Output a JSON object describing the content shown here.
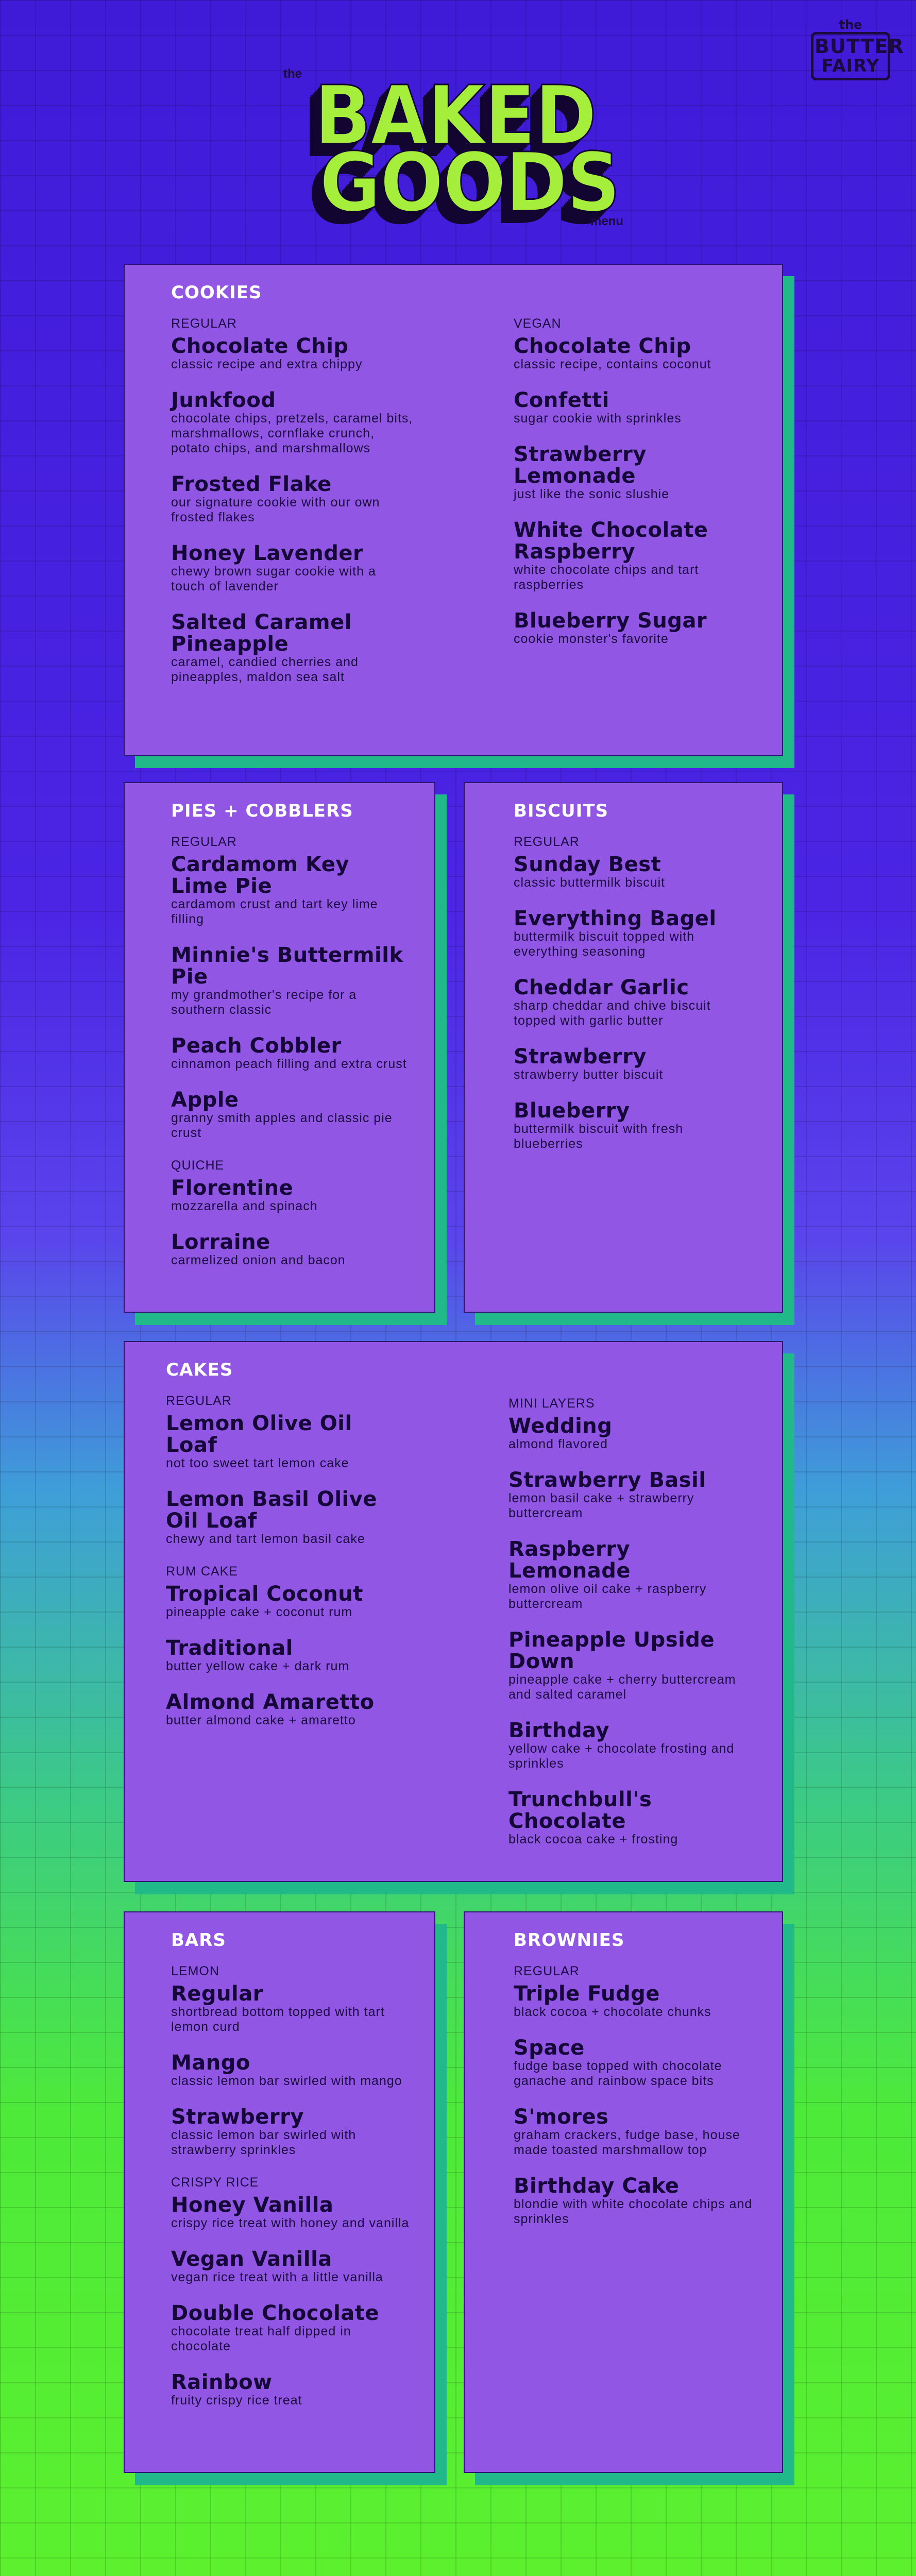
{
  "brand": {
    "the_small": "the",
    "badge_line1": "BUTTER",
    "badge_line2": "FAIRY"
  },
  "header": {
    "the_label": "the",
    "title_line1": "BAKED",
    "title_line2": "GOODS",
    "menu_label": "menu"
  },
  "sections": {
    "cookies": {
      "title": "COOKIES",
      "left": {
        "subhead": "REGULAR",
        "items": [
          {
            "name": "Chocolate Chip",
            "desc": "classic recipe and extra chippy"
          },
          {
            "name": "Junkfood",
            "desc": "chocolate chips, pretzels, caramel bits, marshmallows, cornflake crunch, potato chips, and marshmallows"
          },
          {
            "name": "Frosted Flake",
            "desc": "our signature cookie with our own frosted flakes"
          },
          {
            "name": "Honey Lavender",
            "desc": "chewy brown sugar cookie with a touch of lavender"
          },
          {
            "name": "Salted Caramel Pineapple",
            "desc": "caramel, candied cherries and pineapples, maldon sea salt"
          }
        ]
      },
      "right": {
        "subhead": "VEGAN",
        "items": [
          {
            "name": "Chocolate Chip",
            "desc": "classic recipe, contains coconut"
          },
          {
            "name": "Confetti",
            "desc": "sugar cookie with sprinkles"
          },
          {
            "name": "Strawberry Lemonade",
            "desc": "just like the sonic slushie"
          },
          {
            "name": "White Chocolate Raspberry",
            "desc": "white chocolate chips and tart raspberries"
          },
          {
            "name": "Blueberry Sugar",
            "desc": "cookie monster's favorite"
          }
        ]
      }
    },
    "pies": {
      "title": "PIES + COBBLERS",
      "groups": [
        {
          "subhead": "REGULAR",
          "items": [
            {
              "name": "Cardamom Key Lime Pie",
              "desc": "cardamom crust and tart key lime filling"
            },
            {
              "name": "Minnie's Buttermilk Pie",
              "desc": "my grandmother's recipe for a southern classic"
            },
            {
              "name": "Peach Cobbler",
              "desc": "cinnamon peach filling and extra crust"
            },
            {
              "name": "Apple",
              "desc": "granny smith apples and classic pie crust"
            }
          ]
        },
        {
          "subhead": "QUICHE",
          "items": [
            {
              "name": "Florentine",
              "desc": "mozzarella and spinach"
            },
            {
              "name": "Lorraine",
              "desc": "carmelized onion and bacon"
            }
          ]
        }
      ]
    },
    "biscuits": {
      "title": "BISCUITS",
      "groups": [
        {
          "subhead": "REGULAR",
          "items": [
            {
              "name": "Sunday Best",
              "desc": "classic buttermilk biscuit"
            },
            {
              "name": "Everything Bagel",
              "desc": "buttermilk biscuit topped with everything seasoning"
            },
            {
              "name": "Cheddar Garlic",
              "desc": "sharp cheddar and chive biscuit topped with garlic butter"
            },
            {
              "name": "Strawberry",
              "desc": "strawberry butter biscuit"
            },
            {
              "name": "Blueberry",
              "desc": "buttermilk biscuit with fresh blueberries"
            }
          ]
        }
      ]
    },
    "cakes": {
      "title": "CAKES",
      "left": [
        {
          "subhead": "REGULAR",
          "items": [
            {
              "name": "Lemon Olive Oil Loaf",
              "desc": "not too sweet tart lemon cake"
            },
            {
              "name": "Lemon Basil Olive Oil Loaf",
              "desc": "chewy and tart lemon basil cake"
            }
          ]
        },
        {
          "subhead": "RUM CAKE",
          "items": [
            {
              "name": "Tropical Coconut",
              "desc": "pineapple cake + coconut rum"
            },
            {
              "name": "Traditional",
              "desc": "butter yellow cake + dark rum"
            },
            {
              "name": "Almond Amaretto",
              "desc": "butter almond cake + amaretto"
            }
          ]
        }
      ],
      "right": [
        {
          "subhead": "MINI LAYERS",
          "items": [
            {
              "name": "Wedding",
              "desc": "almond flavored"
            },
            {
              "name": "Strawberry Basil",
              "desc": "lemon basil cake + strawberry buttercream"
            },
            {
              "name": "Raspberry Lemonade",
              "desc": "lemon olive oil cake + raspberry buttercream"
            },
            {
              "name": "Pineapple Upside Down",
              "desc": "pineapple cake + cherry buttercream and salted caramel"
            },
            {
              "name": "Birthday",
              "desc": "yellow cake + chocolate frosting and sprinkles"
            },
            {
              "name": "Trunchbull's Chocolate",
              "desc": "black cocoa cake + frosting"
            }
          ]
        }
      ]
    },
    "bars": {
      "title": "BARS",
      "groups": [
        {
          "subhead": "LEMON",
          "items": [
            {
              "name": "Regular",
              "desc": "shortbread bottom topped with tart lemon curd"
            },
            {
              "name": "Mango",
              "desc": "classic lemon bar swirled with mango"
            },
            {
              "name": "Strawberry",
              "desc": "classic lemon bar swirled with strawberry sprinkles"
            }
          ]
        },
        {
          "subhead": "CRISPY RICE",
          "items": [
            {
              "name": "Honey Vanilla",
              "desc": "crispy rice treat with honey and vanilla"
            },
            {
              "name": "Vegan Vanilla",
              "desc": "vegan rice treat with a little vanilla"
            },
            {
              "name": "Double Chocolate",
              "desc": "chocolate treat half dipped in chocolate"
            },
            {
              "name": "Rainbow",
              "desc": "fruity crispy rice treat"
            }
          ]
        }
      ]
    },
    "brownies": {
      "title": "BROWNIES",
      "groups": [
        {
          "subhead": "REGULAR",
          "items": [
            {
              "name": "Triple Fudge",
              "desc": "black cocoa + chocolate chunks"
            },
            {
              "name": "Space",
              "desc": "fudge base topped with chocolate ganache and rainbow space bits"
            },
            {
              "name": "S'mores",
              "desc": "graham crackers, fudge base, house made toasted marshmallow top"
            },
            {
              "name": "Birthday Cake",
              "desc": "blondie with white chocolate chips and sprinkles"
            }
          ]
        }
      ]
    }
  },
  "colors": {
    "card": "#9156e3",
    "card_shadow": "#22b98a",
    "logo_fill": "#a5ee3c",
    "ink": "#150737"
  }
}
